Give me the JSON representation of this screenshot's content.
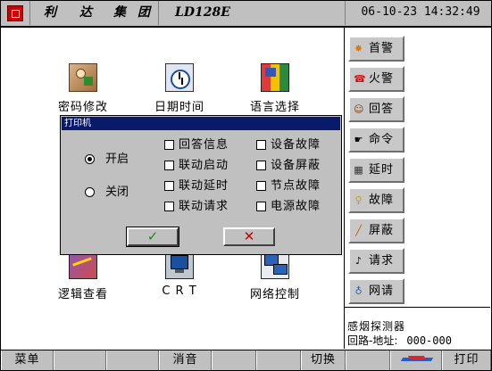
{
  "titlebar": {
    "cells": [
      "利",
      "达",
      "集",
      "团"
    ],
    "model": "LD128E",
    "datetime": "06-10-23 14:32:49"
  },
  "apps": [
    {
      "label": "密码修改",
      "icon": "password-icon"
    },
    {
      "label": "日期时间",
      "icon": "clock-icon"
    },
    {
      "label": "语言选择",
      "icon": "language-icon"
    },
    {
      "label": "逻辑查看",
      "icon": "logic-icon"
    },
    {
      "label": "C R T",
      "icon": "crt-monitor-icon"
    },
    {
      "label": "网络控制",
      "icon": "network-icon"
    }
  ],
  "side_buttons": [
    {
      "label": "首警",
      "icon": "first-alarm-icon"
    },
    {
      "label": "火警",
      "icon": "fire-alarm-icon"
    },
    {
      "label": "回答",
      "icon": "answer-icon"
    },
    {
      "label": "命令",
      "icon": "command-icon"
    },
    {
      "label": "延时",
      "icon": "delay-icon"
    },
    {
      "label": "故障",
      "icon": "fault-icon"
    },
    {
      "label": "屏蔽",
      "icon": "shield-icon"
    },
    {
      "label": "请求",
      "icon": "request-icon"
    },
    {
      "label": "网请",
      "icon": "network-request-icon"
    }
  ],
  "status": {
    "device": "感烟探测器",
    "address_label": "回路-地址:",
    "address_value": "000-000"
  },
  "bottombar": {
    "menu": "菜单",
    "mute": "消音",
    "switch": "切换",
    "print": "打印"
  },
  "dialog": {
    "title": "打印机",
    "radio_on": "开启",
    "radio_off": "关闭",
    "selected": "开启",
    "checkboxes_left": [
      "回答信息",
      "联动启动",
      "联动延时",
      "联动请求"
    ],
    "checkboxes_right": [
      "设备故障",
      "设备屏蔽",
      "节点故障",
      "电源故障"
    ],
    "ok_symbol": "✓",
    "cancel_symbol": "✕"
  },
  "colors": {
    "chrome": "#c0c0c0",
    "dialog_title_bg": "#0a1a6a",
    "ok_green": "#1a8a1a",
    "cancel_red": "#cc0000"
  }
}
